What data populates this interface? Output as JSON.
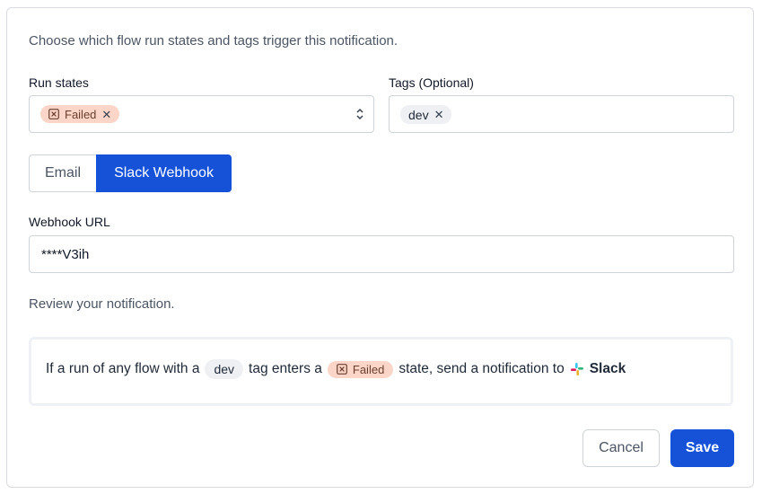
{
  "intro_text": "Choose which flow run states and tags trigger this notification.",
  "run_states": {
    "label": "Run states",
    "selected": [
      {
        "label": "Failed",
        "state_icon": "failed-state-icon",
        "remove_icon": "close-icon"
      }
    ],
    "dropdown_icon": "chevron-up-down-icon"
  },
  "tags": {
    "label": "Tags (Optional)",
    "selected": [
      {
        "label": "dev",
        "remove_icon": "close-icon"
      }
    ]
  },
  "channel_tabs": {
    "email": "Email",
    "slack": "Slack Webhook",
    "active": "Slack Webhook"
  },
  "webhook": {
    "label": "Webhook URL",
    "value": "****V3ih"
  },
  "review_text": "Review your notification.",
  "summary": {
    "part1": "If a run of any flow with a",
    "tag": "dev",
    "part2": "tag enters a",
    "state": "Failed",
    "part3": "state, send a notification to",
    "channel": "Slack",
    "channel_icon": "slack-icon"
  },
  "actions": {
    "cancel": "Cancel",
    "save": "Save"
  },
  "colors": {
    "primary": "#1652d8",
    "failed_bg": "#fbd6c8",
    "tag_bg": "#eef0f3"
  }
}
